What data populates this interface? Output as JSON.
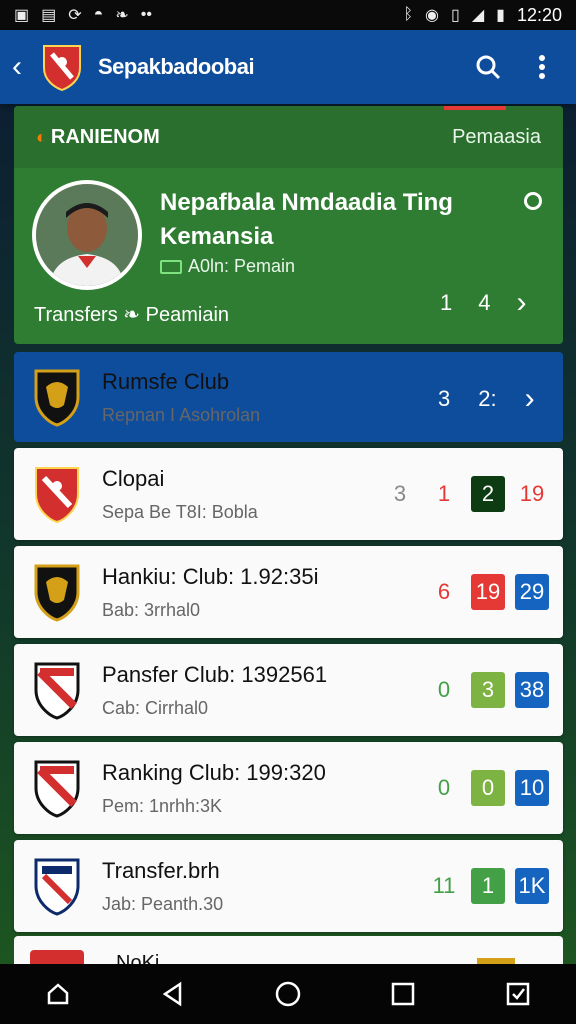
{
  "status_bar": {
    "time": "12:20",
    "left_icons": [
      "gallery-icon",
      "document-icon",
      "sync-icon",
      "android-icon",
      "leaf-icon",
      "more-dots-icon"
    ],
    "right_icons": [
      "bluetooth-icon",
      "wifi-icon",
      "vibrate-icon",
      "signal-icon",
      "battery-icon"
    ]
  },
  "app_bar": {
    "title": "Sepakbadoobai",
    "back_icon": "back-arrow-icon",
    "search_icon": "search-icon",
    "menu_icon": "overflow-menu-icon"
  },
  "featured": {
    "section_label": "RANIENOM",
    "section_right": "Pemaasia",
    "player_name": "Nepafbala Nmdaadia Ting Kemansia",
    "player_sub": "A0ln: Pemain",
    "transfers_label": "Transfers",
    "transfers_right": "Peamiain",
    "num_a": "1",
    "num_b": "4"
  },
  "highlight_club": {
    "name": "Rumsfe Club",
    "sub": "Repnan I Asohrolan",
    "num_a": "3",
    "num_b": "2:"
  },
  "clubs": [
    {
      "name": "Clopai",
      "sub": "Sepa Be T8I: Bobla",
      "scores": [
        "3",
        "1",
        "2",
        "19"
      ]
    },
    {
      "name": "Hankiu: Club: 1.92:35i",
      "sub": "Bab: 3rrhal0",
      "scores": [
        "6",
        "19",
        "29"
      ]
    },
    {
      "name": "Pansfer Club: 1392561",
      "sub": "Cab: Cirrhal0",
      "scores": [
        "0",
        "3",
        "38"
      ]
    },
    {
      "name": "Ranking Club: 199:320",
      "sub": "Pem: 1nrhh:3K",
      "scores": [
        "0",
        "0",
        "10"
      ]
    },
    {
      "name": "Transfer.brh",
      "sub": "Jab: Peanth.30",
      "scores": [
        "11",
        "1",
        "1K"
      ]
    }
  ],
  "partial_row": {
    "text": "NoKi"
  },
  "nav_bar": {
    "icons": [
      "home-outline-icon",
      "back-triangle-icon",
      "home-circle-icon",
      "recents-square-icon",
      "checkbox-icon"
    ]
  }
}
